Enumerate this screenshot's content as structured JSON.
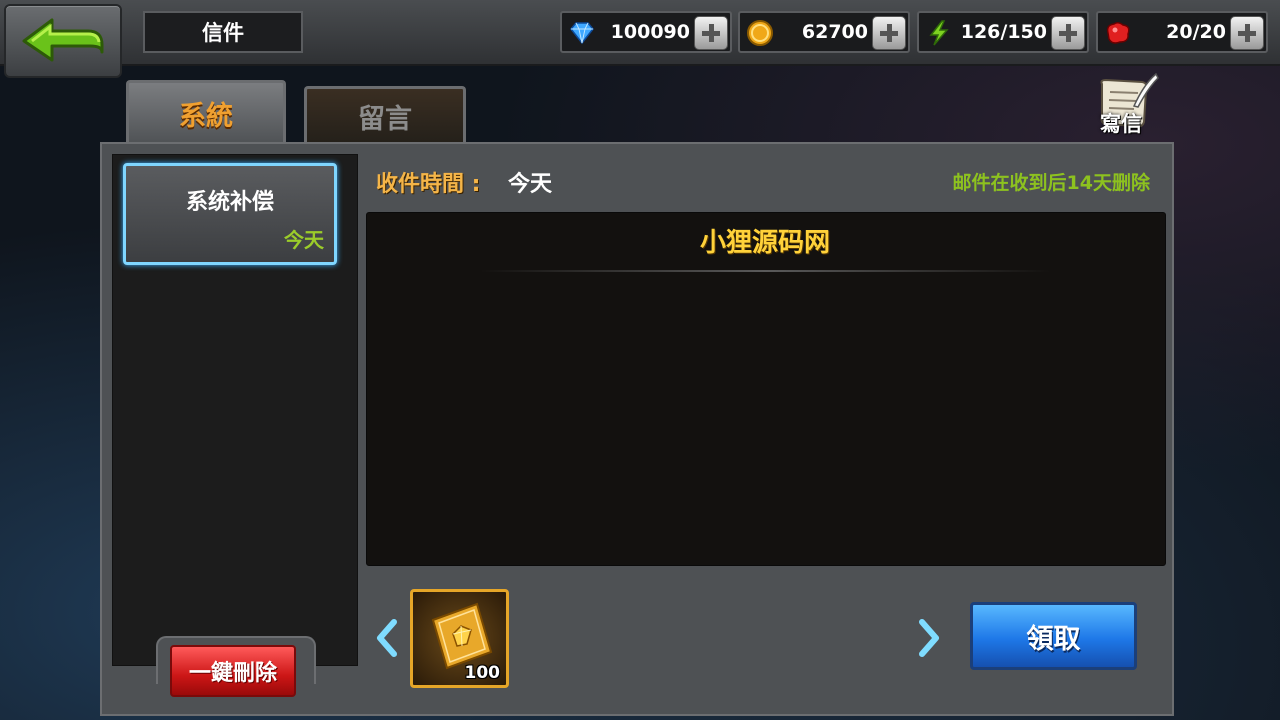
{
  "header": {
    "title": "信件",
    "resources": [
      {
        "name": "diamond",
        "icon": "diamond-icon",
        "value": "100090"
      },
      {
        "name": "gold",
        "icon": "gold-coin-icon",
        "value": "62700"
      },
      {
        "name": "energy",
        "icon": "lightning-icon",
        "value": "126/150"
      },
      {
        "name": "stamina",
        "icon": "red-gem-icon",
        "value": "20/20"
      }
    ]
  },
  "tabs": [
    {
      "label": "系統",
      "active": true
    },
    {
      "label": "留言",
      "active": false
    }
  ],
  "write": {
    "label": "寫信",
    "icon": "quill-letter-icon"
  },
  "mail_list": {
    "items": [
      {
        "title": "系统补偿",
        "date": "今天",
        "selected": true
      }
    ],
    "delete_all_label": "一鍵刪除"
  },
  "mail_detail": {
    "received_label": "收件時間 :",
    "received_value": "今天",
    "expire_note": "邮件在收到后14天删除",
    "subject": "小狸源码网",
    "attachment": {
      "icon": "gold-card-gem-icon",
      "count": "100"
    },
    "claim_label": "領取"
  },
  "colors": {
    "accent_orange": "#f0a030",
    "note_green": "#8dc21f",
    "selected_border": "#7fd6ff",
    "delete_red": "#cc1616",
    "claim_blue": "#1e78e8",
    "subject_yellow": "#ffd23a"
  }
}
